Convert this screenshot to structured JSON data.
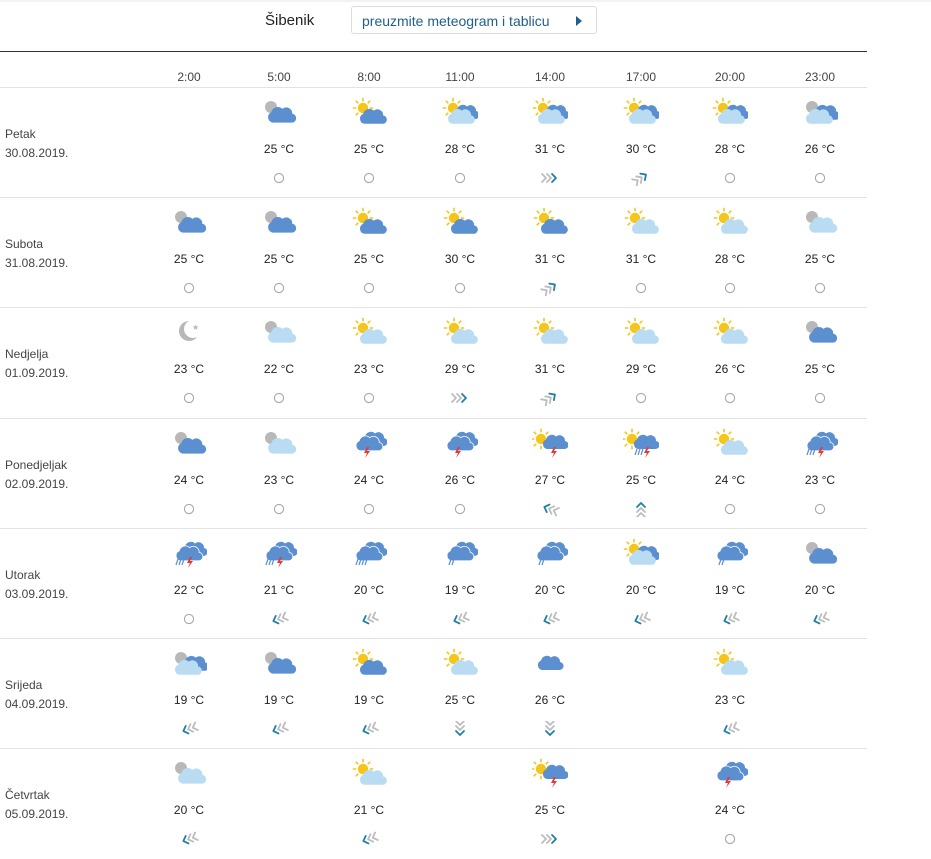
{
  "header": {
    "city": "Šibenik",
    "download_label": "preuzmite meteogram i tablicu"
  },
  "hours": [
    "2:00",
    "5:00",
    "8:00",
    "11:00",
    "14:00",
    "17:00",
    "20:00",
    "23:00"
  ],
  "colors": {
    "cloud_dark": "#5b8fd0",
    "cloud_light": "#b9dcf2",
    "sun": "#f5c518",
    "grey_cloud": "#b8b8b8",
    "wind_blue": "#1f7fa8",
    "wind_grey": "#bdbdbd",
    "lightning": "#e53935"
  },
  "days": [
    {
      "name": "Petak",
      "date": "30.08.2019.",
      "cells": [
        null,
        {
          "icon": "cloud-night",
          "temp": "25 °C",
          "wind": "calm"
        },
        {
          "icon": "sun-cloud",
          "temp": "25 °C",
          "wind": "calm"
        },
        {
          "icon": "sun-cloud-light",
          "temp": "28 °C",
          "wind": "calm"
        },
        {
          "icon": "sun-cloud-light",
          "temp": "31 °C",
          "wind": "wind-east"
        },
        {
          "icon": "sun-cloud-light",
          "temp": "30 °C",
          "wind": "wind-northeast"
        },
        {
          "icon": "sun-cloud-light",
          "temp": "28 °C",
          "wind": "calm"
        },
        {
          "icon": "cloud-night-light",
          "temp": "26 °C",
          "wind": "calm"
        }
      ]
    },
    {
      "name": "Subota",
      "date": "31.08.2019.",
      "cells": [
        {
          "icon": "cloud-night",
          "temp": "25 °C",
          "wind": "calm"
        },
        {
          "icon": "cloud-night",
          "temp": "25 °C",
          "wind": "calm"
        },
        {
          "icon": "sun-cloud",
          "temp": "25 °C",
          "wind": "calm"
        },
        {
          "icon": "sun-cloud",
          "temp": "30 °C",
          "wind": "calm"
        },
        {
          "icon": "sun-cloud",
          "temp": "31 °C",
          "wind": "wind-northeast"
        },
        {
          "icon": "sun-cloud-light-single",
          "temp": "31 °C",
          "wind": "calm"
        },
        {
          "icon": "sun-cloud-light-single",
          "temp": "28 °C",
          "wind": "calm"
        },
        {
          "icon": "cloud-night-light-single",
          "temp": "25 °C",
          "wind": "calm"
        }
      ]
    },
    {
      "name": "Nedjelja",
      "date": "01.09.2019.",
      "cells": [
        {
          "icon": "moon",
          "temp": "23 °C",
          "wind": "calm"
        },
        {
          "icon": "cloud-night-light-single",
          "temp": "22 °C",
          "wind": "calm"
        },
        {
          "icon": "sun-cloud-light-single",
          "temp": "23 °C",
          "wind": "calm"
        },
        {
          "icon": "sun-cloud-light-single",
          "temp": "29 °C",
          "wind": "wind-east"
        },
        {
          "icon": "sun-cloud-light-single",
          "temp": "31 °C",
          "wind": "wind-northeast"
        },
        {
          "icon": "sun-cloud-light-single",
          "temp": "29 °C",
          "wind": "calm"
        },
        {
          "icon": "sun-cloud-light-single",
          "temp": "26 °C",
          "wind": "calm"
        },
        {
          "icon": "cloud-night",
          "temp": "25 °C",
          "wind": "calm"
        }
      ]
    },
    {
      "name": "Ponedjeljak",
      "date": "02.09.2019.",
      "cells": [
        {
          "icon": "cloud-night",
          "temp": "24 °C",
          "wind": "calm"
        },
        {
          "icon": "cloud-night-light-single",
          "temp": "23 °C",
          "wind": "calm"
        },
        {
          "icon": "thunder",
          "temp": "24 °C",
          "wind": "calm"
        },
        {
          "icon": "thunder",
          "temp": "26 °C",
          "wind": "calm"
        },
        {
          "icon": "sun-thunder",
          "temp": "27 °C",
          "wind": "wind-west"
        },
        {
          "icon": "sun-thunder-rain",
          "temp": "25 °C",
          "wind": "wind-north"
        },
        {
          "icon": "sun-cloud-light-single",
          "temp": "24 °C",
          "wind": "calm"
        },
        {
          "icon": "thunder-rain",
          "temp": "23 °C",
          "wind": "calm"
        }
      ]
    },
    {
      "name": "Utorak",
      "date": "03.09.2019.",
      "cells": [
        {
          "icon": "thunder-rain",
          "temp": "22 °C",
          "wind": "calm"
        },
        {
          "icon": "thunder-rain",
          "temp": "21 °C",
          "wind": "wind-southwest"
        },
        {
          "icon": "rain",
          "temp": "20 °C",
          "wind": "wind-southwest"
        },
        {
          "icon": "light-rain",
          "temp": "19 °C",
          "wind": "wind-southwest"
        },
        {
          "icon": "light-rain",
          "temp": "20 °C",
          "wind": "wind-southwest"
        },
        {
          "icon": "sun-cloud-light",
          "temp": "20 °C",
          "wind": "wind-southwest"
        },
        {
          "icon": "light-rain",
          "temp": "19 °C",
          "wind": "wind-southwest"
        },
        {
          "icon": "cloud-night",
          "temp": "20 °C",
          "wind": "wind-southwest"
        }
      ]
    },
    {
      "name": "Srijeda",
      "date": "04.09.2019.",
      "cells": [
        {
          "icon": "cloud-night-light",
          "temp": "19 °C",
          "wind": "wind-southwest"
        },
        {
          "icon": "cloud-night",
          "temp": "19 °C",
          "wind": "wind-southwest"
        },
        {
          "icon": "sun-cloud",
          "temp": "19 °C",
          "wind": "wind-southwest"
        },
        {
          "icon": "sun-cloud-light-single",
          "temp": "25 °C",
          "wind": "wind-south"
        },
        {
          "icon": "cloud",
          "temp": "26 °C",
          "wind": "wind-south"
        },
        null,
        {
          "icon": "sun-cloud-light-single",
          "temp": "23 °C",
          "wind": "wind-southwest"
        },
        null
      ]
    },
    {
      "name": "Četvrtak",
      "date": "05.09.2019.",
      "cells": [
        {
          "icon": "cloud-night-light-single",
          "temp": "20 °C",
          "wind": "wind-southwest"
        },
        null,
        {
          "icon": "sun-cloud-light-single",
          "temp": "21 °C",
          "wind": "wind-southwest"
        },
        null,
        {
          "icon": "sun-thunder",
          "temp": "25 °C",
          "wind": "wind-east"
        },
        null,
        {
          "icon": "thunder",
          "temp": "24 °C",
          "wind": "calm"
        },
        null
      ]
    }
  ]
}
